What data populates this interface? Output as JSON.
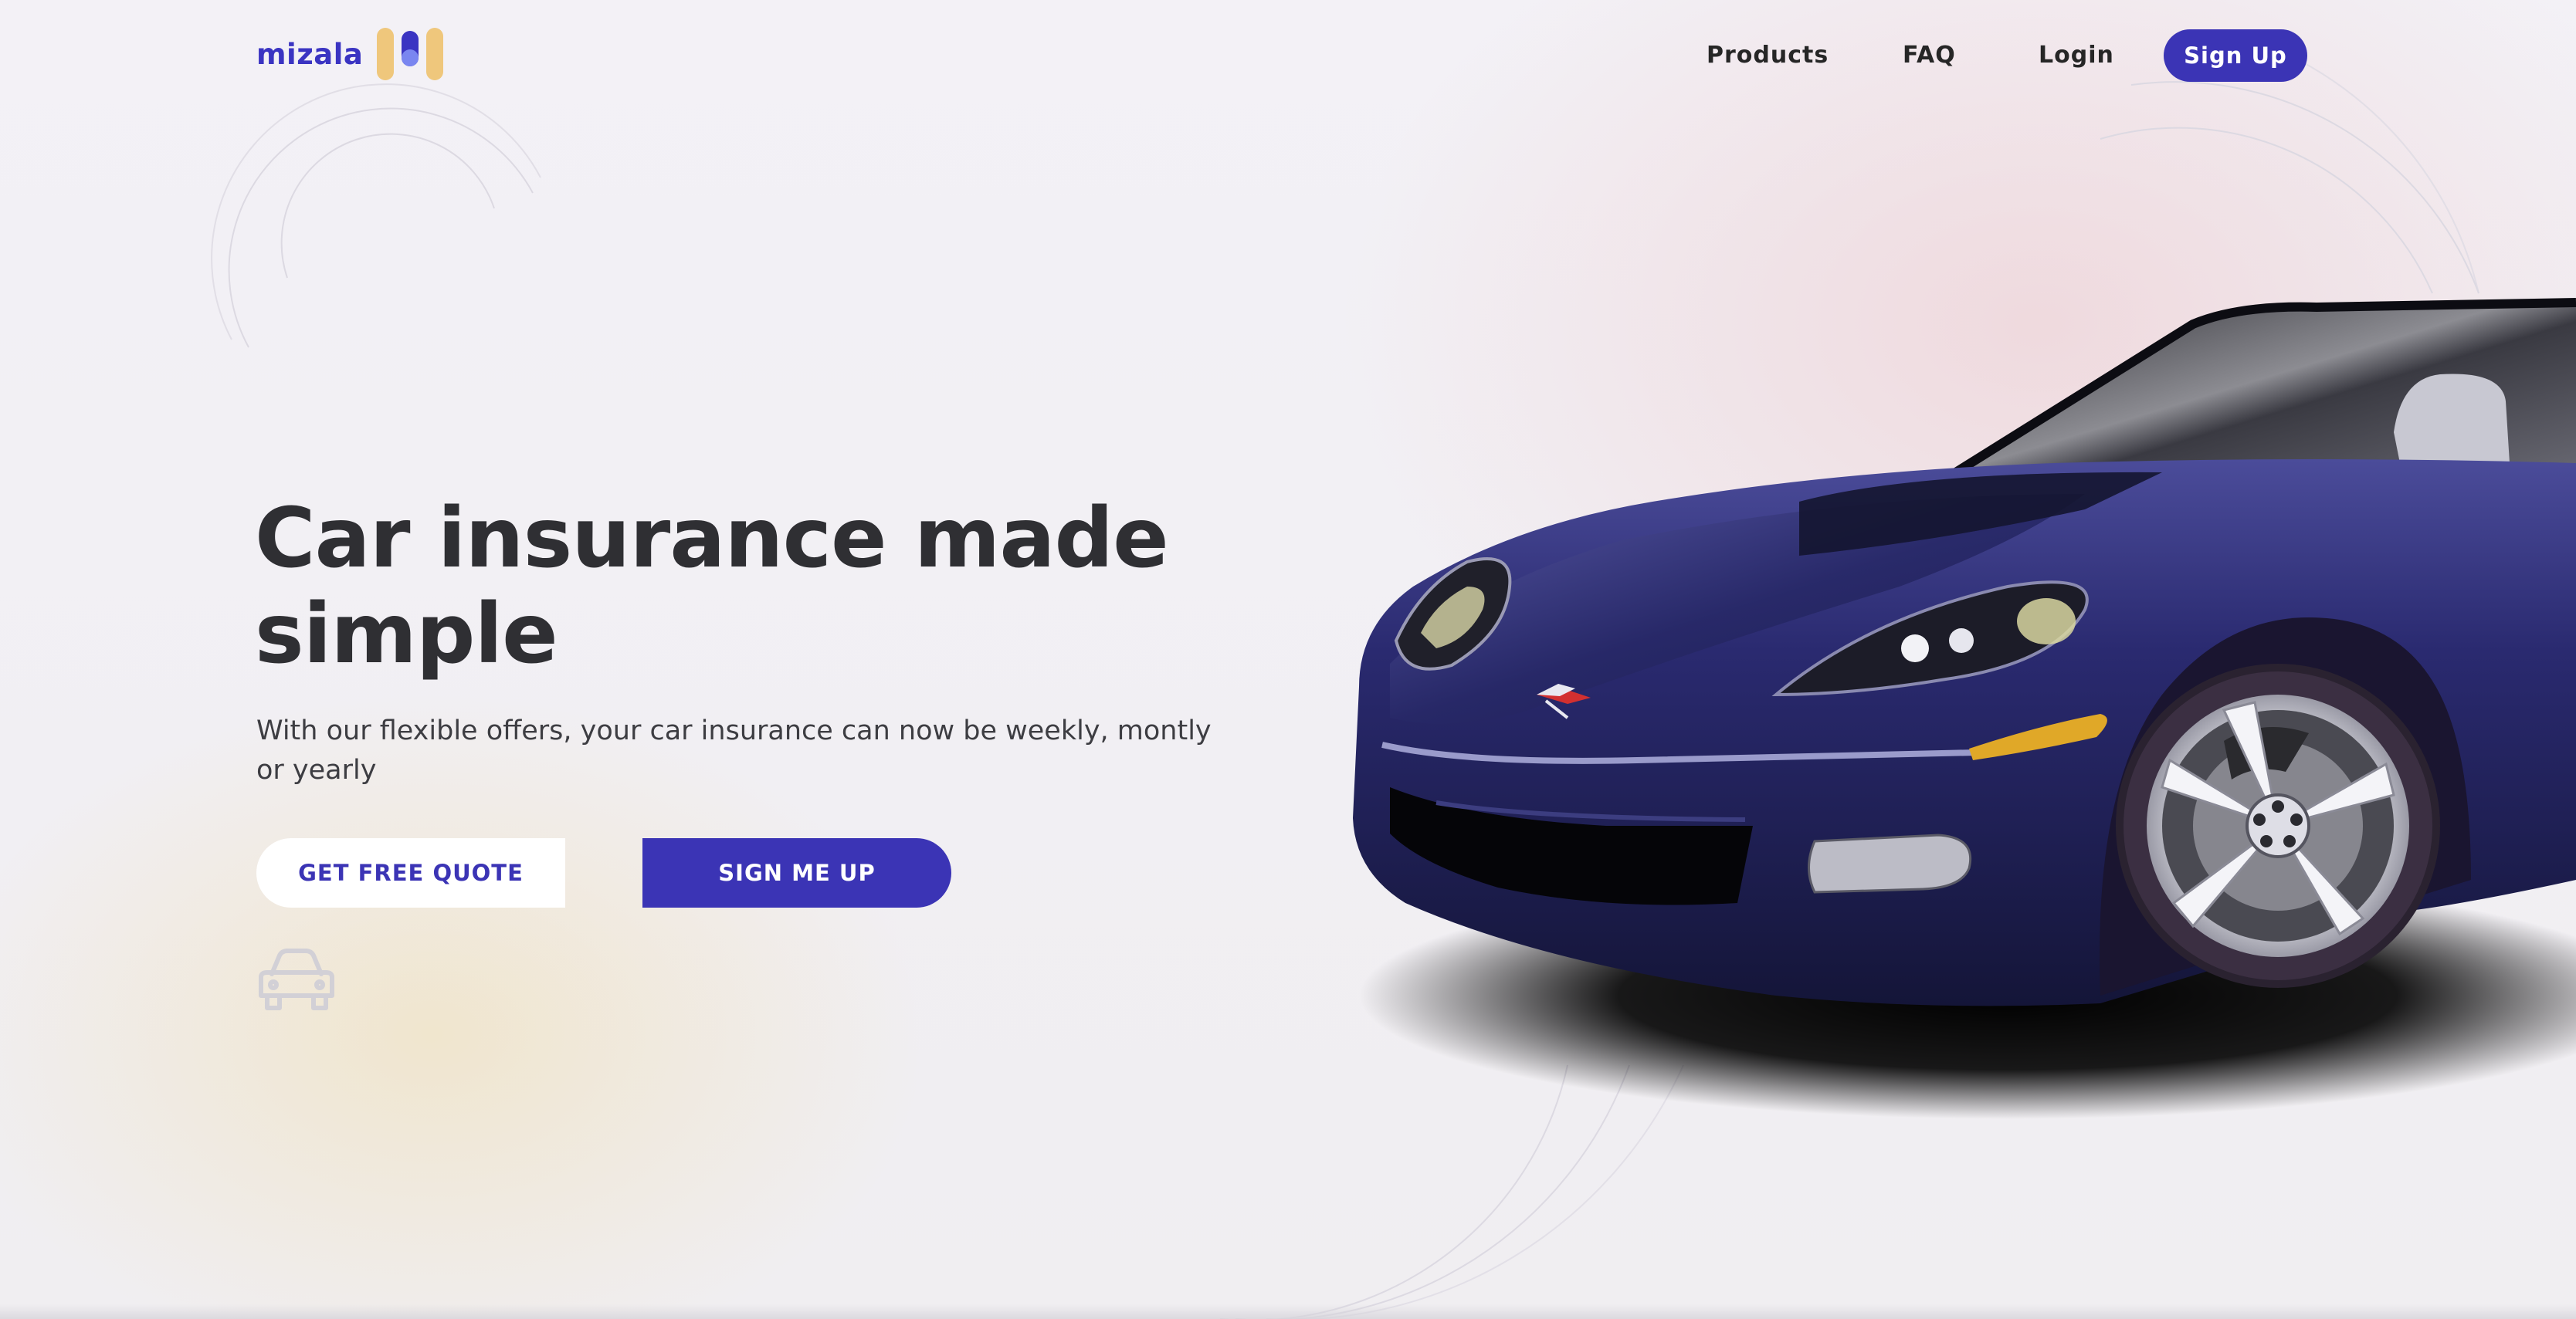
{
  "brand": {
    "name": "mizala",
    "color": "#3a34c2",
    "logo_icon": "pill-stripes-icon"
  },
  "nav": {
    "items": [
      {
        "label": "Products"
      },
      {
        "label": "FAQ"
      },
      {
        "label": "Login"
      }
    ],
    "signup_label": "Sign Up"
  },
  "hero": {
    "title": "Car insurance made simple",
    "subtitle": "With our flexible offers, your car insurance can now be weekly, montly or yearly",
    "primary_cta": "GET FREE QUOTE",
    "secondary_cta": "SIGN ME UP"
  },
  "icons": {
    "car_outline": "car-outline-icon",
    "hero_image": "sports-car-illustration"
  },
  "colors": {
    "accent": "#3b34b5",
    "logo_gold": "#efc77c",
    "heading": "#2f2f33",
    "car_body": "#1f2060"
  }
}
